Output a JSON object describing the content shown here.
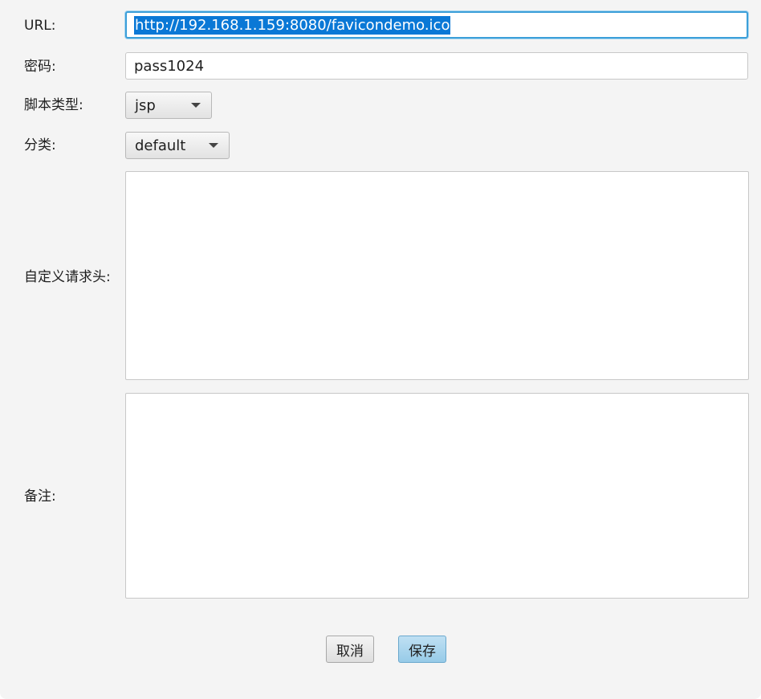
{
  "form": {
    "url_label": "URL:",
    "url_value": "http://192.168.1.159:8080/favicondemo.ico",
    "password_label": "密码:",
    "password_value": "pass1024",
    "script_type_label": "脚本类型:",
    "script_type_value": "jsp",
    "category_label": "分类:",
    "category_value": "default",
    "headers_label": "自定义请求头:",
    "headers_value": "",
    "notes_label": "备注:",
    "notes_value": ""
  },
  "buttons": {
    "cancel_label": "取消",
    "save_label": "保存"
  },
  "icons": {
    "dropdown": "triangle-down-icon"
  },
  "colors": {
    "dialog_bg": "#f4f4f4",
    "focus_border": "#3c9fd9",
    "selection_bg": "#0a78d6",
    "primary_button": "#a8d4ee"
  }
}
